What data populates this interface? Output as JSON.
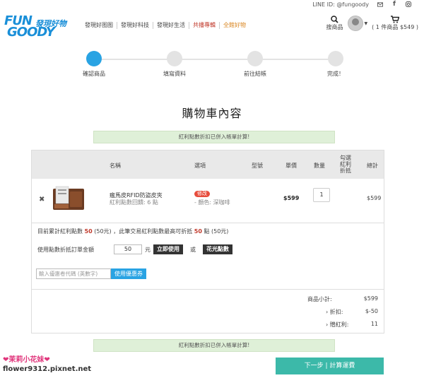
{
  "topbar": {
    "line_id": "LINE ID: @fungoody",
    "mail_icon": "mail-icon",
    "fb_icon": "facebook-icon",
    "ig_icon": "instagram-icon"
  },
  "logo": {
    "fun": "FUN",
    "goody": "GOODY",
    "cn": "發現好物"
  },
  "nav": [
    "發現好图图",
    "發現好科技",
    "發現好生活",
    "共播專輯",
    "全館好物"
  ],
  "header": {
    "search_label": "搜商品",
    "cart_label": "( 1 件商品 $549 )"
  },
  "steps": [
    "確認商品",
    "填寫資料",
    "前往結帳",
    "完成！"
  ],
  "page_title": "購物車內容",
  "notice": "紅利點數折扣已併入帳單計算!",
  "table": {
    "headers": {
      "name": "名稱",
      "option": "選項",
      "model": "型號",
      "unit_price": "單價",
      "qty": "數量",
      "pick1": "勾選",
      "pick2": "紅利",
      "pick3": "折抵",
      "subtotal": "總計"
    },
    "item": {
      "name": "瘋馬皮RFID防盜皮夾",
      "points": "紅利點數回饋: 6 點",
      "tag": "修改",
      "option": "- 顏色: 深咖啡",
      "price": "$599",
      "qty": "1",
      "subtotal": "$599"
    }
  },
  "points": {
    "line1_a": "目前累計紅利點數",
    "line1_pts": "50",
    "line1_b": "(50元) ，此筆交易紅利點數最高可折抵",
    "line1_max": "50",
    "line1_c": "點 (50元)",
    "use_label": "使用點數折抵訂單金額",
    "use_value": "50",
    "unit": "元",
    "apply_btn": "立即使用",
    "or": "或",
    "spend_all_btn": "花光點數"
  },
  "coupon": {
    "placeholder": "輸入優惠卷代碼 (英數字)",
    "btn": "使用優惠券"
  },
  "summary": {
    "subtotal_label": "商品小計:",
    "subtotal_value": "$599",
    "discount_label": "› 折扣:",
    "discount_value": "$-50",
    "bonus_label": "› 贈紅利:",
    "bonus_value": "11"
  },
  "next_btn": "下一步 | 計算運費",
  "watermark": {
    "line1": "❤茉莉小花妹❤",
    "line2": "flower9312.pixnet.net"
  }
}
